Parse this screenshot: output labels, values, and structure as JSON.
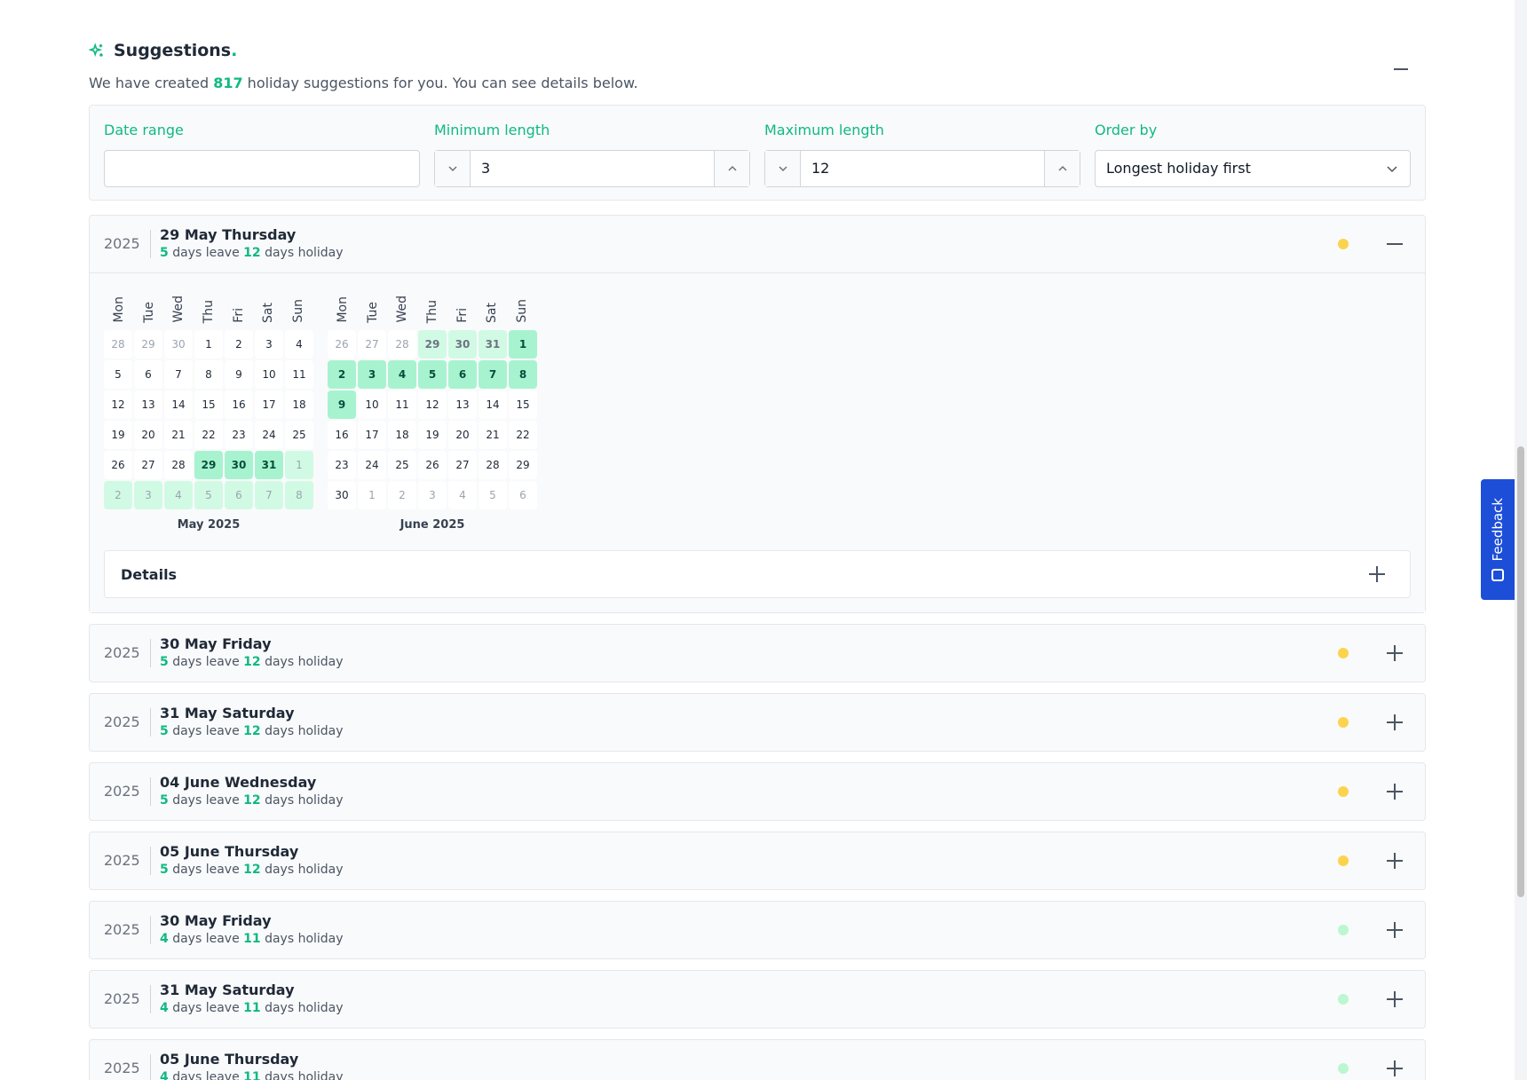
{
  "header": {
    "title": "Suggestions",
    "title_dot": ".",
    "sub_prefix": "We have created ",
    "count": "817",
    "sub_suffix": " holiday suggestions for you. You can see details below."
  },
  "filters": {
    "date_range": {
      "label": "Date range",
      "value": ""
    },
    "min_length": {
      "label": "Minimum length",
      "value": "3"
    },
    "max_length": {
      "label": "Maximum length",
      "value": "12"
    },
    "order_by": {
      "label": "Order by",
      "value": "Longest holiday first"
    }
  },
  "colors": {
    "accent": "#10b981",
    "status_yellow": "#fcd34d",
    "status_green": "#bbf7d0",
    "holiday": "#a7f3d0",
    "feedback": "#1d4ed8"
  },
  "expanded": {
    "year": "2025",
    "date": "29 May Thursday",
    "leave": "5",
    "leave_text": " days leave ",
    "holiday": "12",
    "holiday_text": " days holiday",
    "status": "yellow",
    "weekdays": [
      "Mon",
      "Tue",
      "Wed",
      "Thu",
      "Fri",
      "Sat",
      "Sun"
    ],
    "months": [
      {
        "name": "May 2025",
        "days": [
          [
            "28",
            "o"
          ],
          [
            "29",
            "o"
          ],
          [
            "30",
            "o"
          ],
          [
            "1",
            ""
          ],
          [
            "2",
            ""
          ],
          [
            "3",
            ""
          ],
          [
            "4",
            ""
          ],
          [
            "5",
            ""
          ],
          [
            "6",
            ""
          ],
          [
            "7",
            ""
          ],
          [
            "8",
            ""
          ],
          [
            "9",
            ""
          ],
          [
            "10",
            ""
          ],
          [
            "11",
            ""
          ],
          [
            "12",
            ""
          ],
          [
            "13",
            ""
          ],
          [
            "14",
            ""
          ],
          [
            "15",
            ""
          ],
          [
            "16",
            ""
          ],
          [
            "17",
            ""
          ],
          [
            "18",
            ""
          ],
          [
            "19",
            ""
          ],
          [
            "20",
            ""
          ],
          [
            "21",
            ""
          ],
          [
            "22",
            ""
          ],
          [
            "23",
            ""
          ],
          [
            "24",
            ""
          ],
          [
            "25",
            ""
          ],
          [
            "26",
            ""
          ],
          [
            "27",
            ""
          ],
          [
            "28",
            ""
          ],
          [
            "29",
            "h"
          ],
          [
            "30",
            "h"
          ],
          [
            "31",
            "h"
          ],
          [
            "1",
            "oh"
          ],
          [
            "2",
            "oh"
          ],
          [
            "3",
            "oh"
          ],
          [
            "4",
            "oh"
          ],
          [
            "5",
            "oh"
          ],
          [
            "6",
            "oh"
          ],
          [
            "7",
            "oh"
          ],
          [
            "8",
            "oh"
          ]
        ]
      },
      {
        "name": "June 2025",
        "days": [
          [
            "26",
            "o"
          ],
          [
            "27",
            "o"
          ],
          [
            "28",
            "o"
          ],
          [
            "29",
            "ho"
          ],
          [
            "30",
            "ho"
          ],
          [
            "31",
            "ho"
          ],
          [
            "1",
            "h"
          ],
          [
            "2",
            "h"
          ],
          [
            "3",
            "h"
          ],
          [
            "4",
            "h"
          ],
          [
            "5",
            "h"
          ],
          [
            "6",
            "h"
          ],
          [
            "7",
            "h"
          ],
          [
            "8",
            "h"
          ],
          [
            "9",
            "h"
          ],
          [
            "10",
            ""
          ],
          [
            "11",
            ""
          ],
          [
            "12",
            ""
          ],
          [
            "13",
            ""
          ],
          [
            "14",
            ""
          ],
          [
            "15",
            ""
          ],
          [
            "16",
            ""
          ],
          [
            "17",
            ""
          ],
          [
            "18",
            ""
          ],
          [
            "19",
            ""
          ],
          [
            "20",
            ""
          ],
          [
            "21",
            ""
          ],
          [
            "22",
            ""
          ],
          [
            "23",
            ""
          ],
          [
            "24",
            ""
          ],
          [
            "25",
            ""
          ],
          [
            "26",
            ""
          ],
          [
            "27",
            ""
          ],
          [
            "28",
            ""
          ],
          [
            "29",
            ""
          ],
          [
            "30",
            ""
          ],
          [
            "1",
            "o"
          ],
          [
            "2",
            "o"
          ],
          [
            "3",
            "o"
          ],
          [
            "4",
            "o"
          ],
          [
            "5",
            "o"
          ],
          [
            "6",
            "o"
          ]
        ]
      }
    ],
    "details_label": "Details"
  },
  "suggestions": [
    {
      "year": "2025",
      "date": "30 May Friday",
      "leave": "5",
      "holiday": "12",
      "status": "yellow"
    },
    {
      "year": "2025",
      "date": "31 May Saturday",
      "leave": "5",
      "holiday": "12",
      "status": "yellow"
    },
    {
      "year": "2025",
      "date": "04 June Wednesday",
      "leave": "5",
      "holiday": "12",
      "status": "yellow"
    },
    {
      "year": "2025",
      "date": "05 June Thursday",
      "leave": "5",
      "holiday": "12",
      "status": "yellow"
    },
    {
      "year": "2025",
      "date": "30 May Friday",
      "leave": "4",
      "holiday": "11",
      "status": "green"
    },
    {
      "year": "2025",
      "date": "31 May Saturday",
      "leave": "4",
      "holiday": "11",
      "status": "green"
    },
    {
      "year": "2025",
      "date": "05 June Thursday",
      "leave": "4",
      "holiday": "11",
      "status": "green"
    }
  ],
  "leave_text": " days leave ",
  "holiday_text": " days holiday",
  "feedback": {
    "label": "Feedback"
  }
}
